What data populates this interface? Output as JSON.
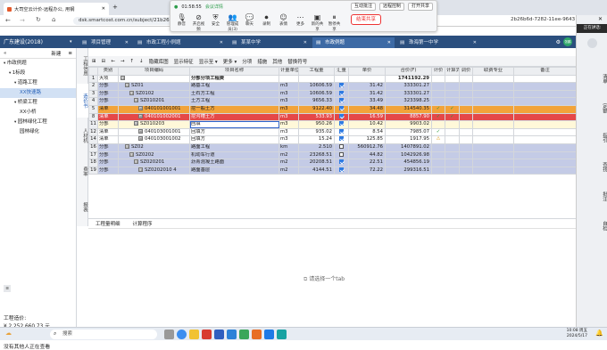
{
  "browser": {
    "tab_title": "大司空云计价-远程办公, 用钢",
    "url": "dsk.smartcost.com.cn/subject/21b26b40",
    "url_tail": "2b26b6d-7282-11ee-9643"
  },
  "meeting": {
    "timer": "01:58:55",
    "secure": "会议详情",
    "interact": "互动批注",
    "remote": "远程控制",
    "doc": "打开共享",
    "end_label": "结束共享",
    "icons": [
      {
        "name": "mic-icon",
        "label": "静音",
        "glyph": "🎙"
      },
      {
        "name": "video-icon",
        "label": "开启视频",
        "glyph": "⊘"
      },
      {
        "name": "security-icon",
        "label": "安全",
        "glyph": "⛨"
      },
      {
        "name": "members-icon",
        "label": "管理成员(3)",
        "glyph": "👥"
      },
      {
        "name": "chat-icon",
        "label": "聊天",
        "glyph": "💬"
      },
      {
        "name": "record-icon",
        "label": "录制",
        "glyph": "⏺"
      },
      {
        "name": "reaction-icon",
        "label": "表情",
        "glyph": "☺"
      },
      {
        "name": "more-icon",
        "label": "更多",
        "glyph": "⋯"
      },
      {
        "name": "new-share-icon",
        "label": "新的共享",
        "glyph": "▣"
      },
      {
        "name": "pause-share-icon",
        "label": "暂停共享",
        "glyph": "⏸"
      }
    ]
  },
  "right_panel": {
    "status": "正在讲话:",
    "items": [
      "清单",
      "定额",
      "指引",
      "查找",
      "批注",
      "自检"
    ]
  },
  "app": {
    "project_label": "广东建设(2018)",
    "tabs": [
      "项目管理",
      "市政工程小例题",
      "某某中学",
      "市政例题",
      "珠海第一中学"
    ],
    "active_tab_index": 3,
    "user_initial": "张鹏"
  },
  "left_panel": {
    "toolbar": [
      "新建",
      "≡"
    ],
    "tree": [
      {
        "label": "市政例题",
        "indent": 0
      },
      {
        "label": "1标段",
        "indent": 1
      },
      {
        "label": "道路工程",
        "indent": 2
      },
      {
        "label": "XX快速路",
        "indent": 3,
        "selected": true
      },
      {
        "label": "桥梁工程",
        "indent": 2
      },
      {
        "label": "XX小桥",
        "indent": 3
      },
      {
        "label": "园林绿化工程",
        "indent": 2
      },
      {
        "label": "园林绿化",
        "indent": 3
      }
    ],
    "cost_label": "工程造价:",
    "cost_value": "¥ 2,252,660.73 元",
    "viewers": "没有其他人正在查看"
  },
  "vertical_tabs": [
    "工程信息",
    "造价书",
    "人材机",
    "费率",
    "报表"
  ],
  "toolbar": {
    "items": [
      "⊞",
      "⊟",
      "←",
      "→",
      "↑",
      "↓",
      "隐藏库图",
      "显示特征",
      "显示至 ▾",
      "更多 ▾",
      "分项",
      "措施",
      "其他",
      "替换符号"
    ]
  },
  "grid": {
    "headers": [
      "",
      "类别",
      "项目编码",
      "项目名称",
      "计量单位",
      "工程量",
      "汇量",
      "单价",
      "合价(F)",
      "计价",
      "计算式",
      "调价",
      "取费专业",
      "备注"
    ],
    "rows": [
      {
        "n": "1",
        "cat": "大项",
        "code": "",
        "tog": "⊟",
        "indent": 0,
        "name": "分部分项工程费",
        "unit": "",
        "qty": "",
        "chk": "",
        "price": "",
        "total": "1741192.29",
        "mark": "",
        "style": "",
        "bold": true
      },
      {
        "n": "2",
        "cat": "分部",
        "code": "SZ01",
        "tog": "⊟",
        "indent": 1,
        "name": "路基工程",
        "unit": "m3",
        "qty": "10606.59",
        "chk": "on",
        "price": "31.42",
        "total": "333301.27",
        "mark": "",
        "style": "grey"
      },
      {
        "n": "3",
        "cat": "分部",
        "code": "SZ0102",
        "tog": "⊟",
        "indent": 2,
        "name": "土石方工程",
        "unit": "m3",
        "qty": "10606.59",
        "chk": "on",
        "price": "31.42",
        "total": "333301.27",
        "mark": "",
        "style": "grey"
      },
      {
        "n": "4",
        "cat": "分部",
        "code": "SZ010201",
        "tog": "⊟",
        "indent": 3,
        "name": "土方工程",
        "unit": "m3",
        "qty": "9656.33",
        "chk": "on",
        "price": "33.49",
        "total": "323398.25",
        "mark": "",
        "style": "grey"
      },
      {
        "n": "5",
        "cat": "清单",
        "code": "040101001001",
        "tog": "⊞",
        "indent": 4,
        "name": "挖一般土方",
        "unit": "m3",
        "qty": "9122.40",
        "chk": "on",
        "price": "34.48",
        "total": "314540.35",
        "mark": "✓",
        "style": "orange"
      },
      {
        "n": "8",
        "cat": "清单",
        "code": "040101002001",
        "tog": "⊞",
        "indent": 4,
        "name": "挖沟槽土方",
        "unit": "m3",
        "qty": "533.93",
        "chk": "on",
        "price": "16.59",
        "total": "8857.90",
        "mark": "✓",
        "style": "red"
      },
      {
        "n": "11",
        "cat": "分部",
        "code": "SZ010203",
        "tog": "⊟",
        "indent": 3,
        "name": "回填",
        "unit": "m3",
        "qty": "950.26",
        "chk": "on",
        "price": "10.42",
        "total": "9903.02",
        "mark": "",
        "style": "yellow",
        "editing": true
      },
      {
        "n": "12",
        "cat": "清单",
        "code": "040103001001",
        "tog": "⊞",
        "indent": 4,
        "name": "回填方",
        "unit": "m3",
        "qty": "935.02",
        "chk": "on",
        "price": "8.54",
        "total": "7985.07",
        "mark": "✓",
        "style": ""
      },
      {
        "n": "14",
        "cat": "清单",
        "code": "040103001002",
        "tog": "⊞",
        "indent": 4,
        "name": "回填方",
        "unit": "m3",
        "qty": "15.24",
        "chk": "on",
        "price": "125.85",
        "total": "1917.95",
        "mark": "⚠",
        "style": ""
      },
      {
        "n": "16",
        "cat": "分部",
        "code": "SZ02",
        "tog": "⊟",
        "indent": 1,
        "name": "路面工程",
        "unit": "km",
        "qty": "2.510",
        "chk": "",
        "price": "560912.76",
        "total": "1407891.02",
        "mark": "",
        "style": "grey"
      },
      {
        "n": "17",
        "cat": "分部",
        "code": "SZ0202",
        "tog": "⊟",
        "indent": 2,
        "name": "机动车行道",
        "unit": "m2",
        "qty": "23268.51",
        "chk": "",
        "price": "44.82",
        "total": "1042926.98",
        "mark": "",
        "style": "grey"
      },
      {
        "n": "18",
        "cat": "分部",
        "code": "SZ020201",
        "tog": "⊟",
        "indent": 3,
        "name": "沥青混凝土路面",
        "unit": "m2",
        "qty": "20208.51",
        "chk": "on",
        "price": "22.51",
        "total": "454856.19",
        "mark": "",
        "style": "grey"
      },
      {
        "n": "19",
        "cat": "分部",
        "code": "SZ0202010 4",
        "tog": "⊟",
        "indent": 4,
        "name": "路面基层",
        "unit": "m2",
        "qty": "4144.51",
        "chk": "on",
        "price": "72.22",
        "total": "299316.51",
        "mark": "",
        "style": "grey"
      }
    ]
  },
  "bottom_tabs": [
    "工程量明细",
    "计算程序"
  ],
  "empty_message": "请选择一个tab",
  "taskbar": {
    "search_placeholder": "搜索",
    "time": "10:08 周五",
    "date": "2024/5/17"
  }
}
